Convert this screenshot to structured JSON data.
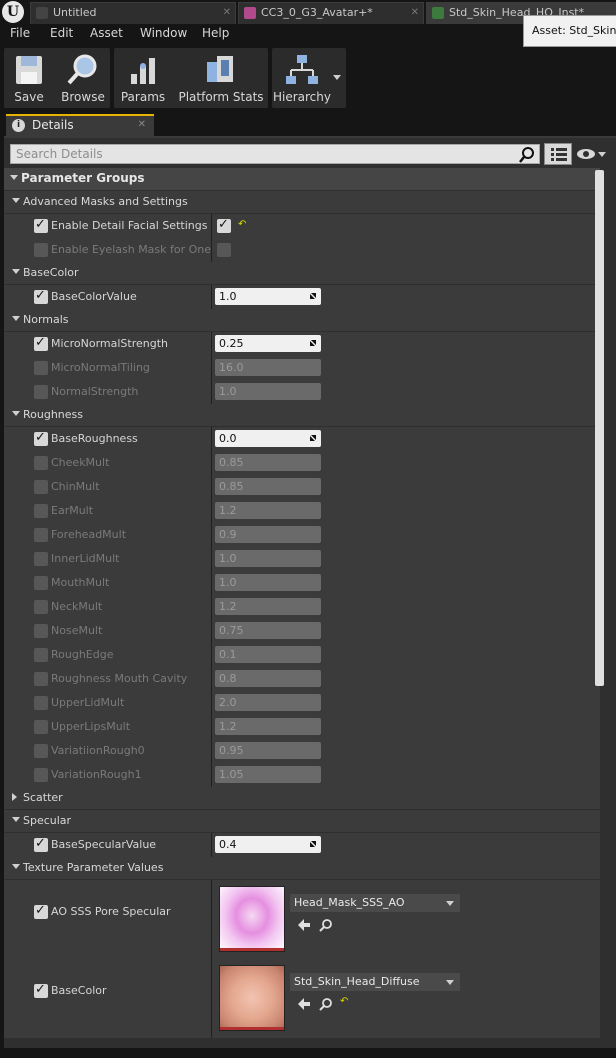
{
  "tabs": [
    {
      "label": "Untitled",
      "icon": "level-icon",
      "icon_color": "#444444"
    },
    {
      "label": "CC3_0_G3_Avatar+*",
      "icon": "material-icon",
      "icon_color": "#b04a8a"
    },
    {
      "label": "Std_Skin_Head_HQ_Inst*",
      "icon": "material-instance-icon",
      "icon_color": "#3d7a3d"
    }
  ],
  "asset_tooltip": "Asset: Std_Skin_Head_HQ_Inst",
  "menu": [
    "File",
    "Edit",
    "Asset",
    "Window",
    "Help"
  ],
  "toolbar": {
    "save": "Save",
    "browse": "Browse",
    "params": "Params",
    "platform_stats": "Platform Stats",
    "hierarchy": "Hierarchy"
  },
  "details_tab": {
    "label": "Details"
  },
  "search": {
    "placeholder": "Search Details",
    "value": ""
  },
  "parameter_groups": {
    "title": "Parameter Groups",
    "groups": [
      {
        "name": "Advanced Masks and Settings",
        "expanded": true,
        "params": [
          {
            "label": "Enable Detail Facial Settings",
            "enabled": true,
            "type": "bool",
            "value": true,
            "reset": true
          },
          {
            "label": "Enable Eyelash Mask for One Mesh",
            "enabled": false,
            "type": "bool",
            "value": false
          }
        ]
      },
      {
        "name": "BaseColor",
        "expanded": true,
        "params": [
          {
            "label": "BaseColorValue",
            "enabled": true,
            "type": "scalar",
            "value": "1.0"
          }
        ]
      },
      {
        "name": "Normals",
        "expanded": true,
        "params": [
          {
            "label": "MicroNormalStrength",
            "enabled": true,
            "type": "scalar",
            "value": "0.25"
          },
          {
            "label": "MicroNormalTiling",
            "enabled": false,
            "type": "scalar",
            "value": "16.0"
          },
          {
            "label": "NormalStrength",
            "enabled": false,
            "type": "scalar",
            "value": "1.0"
          }
        ]
      },
      {
        "name": "Roughness",
        "expanded": true,
        "params": [
          {
            "label": "BaseRoughness",
            "enabled": true,
            "type": "scalar",
            "value": "0.0"
          },
          {
            "label": "CheekMult",
            "enabled": false,
            "type": "scalar",
            "value": "0.85"
          },
          {
            "label": "ChinMult",
            "enabled": false,
            "type": "scalar",
            "value": "0.85"
          },
          {
            "label": "EarMult",
            "enabled": false,
            "type": "scalar",
            "value": "1.2"
          },
          {
            "label": "ForeheadMult",
            "enabled": false,
            "type": "scalar",
            "value": "0.9"
          },
          {
            "label": "InnerLidMult",
            "enabled": false,
            "type": "scalar",
            "value": "1.0"
          },
          {
            "label": "MouthMult",
            "enabled": false,
            "type": "scalar",
            "value": "1.0"
          },
          {
            "label": "NeckMult",
            "enabled": false,
            "type": "scalar",
            "value": "1.2"
          },
          {
            "label": "NoseMult",
            "enabled": false,
            "type": "scalar",
            "value": "0.75"
          },
          {
            "label": "RoughEdge",
            "enabled": false,
            "type": "scalar",
            "value": "0.1"
          },
          {
            "label": "Roughness Mouth Cavity",
            "enabled": false,
            "type": "scalar",
            "value": "0.8"
          },
          {
            "label": "UpperLidMult",
            "enabled": false,
            "type": "scalar",
            "value": "2.0"
          },
          {
            "label": "UpperLipsMult",
            "enabled": false,
            "type": "scalar",
            "value": "1.2"
          },
          {
            "label": "VariatiionRough0",
            "enabled": false,
            "type": "scalar",
            "value": "0.95"
          },
          {
            "label": "VariationRough1",
            "enabled": false,
            "type": "scalar",
            "value": "1.05"
          }
        ]
      },
      {
        "name": "Scatter",
        "expanded": false,
        "params": []
      },
      {
        "name": "Specular",
        "expanded": true,
        "params": [
          {
            "label": "BaseSpecularValue",
            "enabled": true,
            "type": "scalar",
            "value": "0.4"
          }
        ]
      },
      {
        "name": "Texture Parameter Values",
        "expanded": true,
        "params": [
          {
            "label": "AO SSS Pore Specular",
            "enabled": true,
            "type": "texture",
            "value": "Head_Mask_SSS_AO",
            "thumb": "pink-mask",
            "reset": false
          },
          {
            "label": "BaseColor",
            "enabled": true,
            "type": "texture",
            "value": "Std_Skin_Head_Diffuse",
            "thumb": "skin",
            "reset": true
          }
        ]
      }
    ]
  },
  "colors": {
    "accent": "#e7b300",
    "panel_bg": "#2f2f2f",
    "row_bg": "#3b3b3b",
    "reset_arrow": "#d7d700"
  }
}
